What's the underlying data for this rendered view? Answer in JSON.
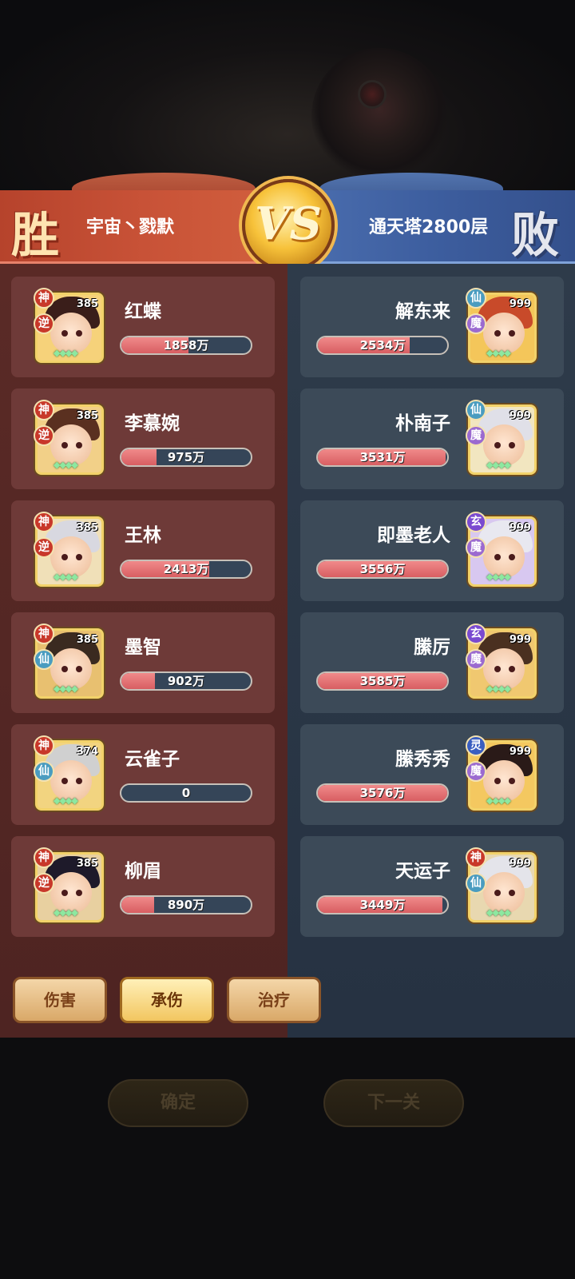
{
  "banner": {
    "left_result": "胜",
    "left_team": "宇宙丶戮默",
    "vs_label": "VS",
    "right_team": "通天塔2800层",
    "right_result": "败"
  },
  "left_heroes": [
    {
      "name": "红蝶",
      "level": "385",
      "tag1": "神",
      "tag2": "逆",
      "value": "1858万",
      "fill": 0.52
    },
    {
      "name": "李慕婉",
      "level": "385",
      "tag1": "神",
      "tag2": "逆",
      "value": "975万",
      "fill": 0.27
    },
    {
      "name": "王林",
      "level": "385",
      "tag1": "神",
      "tag2": "逆",
      "value": "2413万",
      "fill": 0.68
    },
    {
      "name": "墨智",
      "level": "385",
      "tag1": "神",
      "tag2": "仙",
      "value": "902万",
      "fill": 0.26
    },
    {
      "name": "云雀子",
      "level": "374",
      "tag1": "神",
      "tag2": "仙",
      "value": "0",
      "fill": 0
    },
    {
      "name": "柳眉",
      "level": "385",
      "tag1": "神",
      "tag2": "逆",
      "value": "890万",
      "fill": 0.25
    }
  ],
  "right_heroes": [
    {
      "name": "解东来",
      "level": "999",
      "tag1": "仙",
      "tag2": "魔",
      "value": "2534万",
      "fill": 0.71
    },
    {
      "name": "朴南子",
      "level": "999",
      "tag1": "仙",
      "tag2": "魔",
      "value": "3531万",
      "fill": 0.99
    },
    {
      "name": "即墨老人",
      "level": "999",
      "tag1": "玄",
      "tag2": "魔",
      "value": "3556万",
      "fill": 1.0
    },
    {
      "name": "縢厉",
      "level": "999",
      "tag1": "玄",
      "tag2": "魔",
      "value": "3585万",
      "fill": 1.0
    },
    {
      "name": "縢秀秀",
      "level": "999",
      "tag1": "灵",
      "tag2": "魔",
      "value": "3576万",
      "fill": 1.0
    },
    {
      "name": "天运子",
      "level": "999",
      "tag1": "神",
      "tag2": "仙",
      "value": "3449万",
      "fill": 0.96
    }
  ],
  "tabs": [
    "伤害",
    "承伤",
    "治疗"
  ],
  "active_tab": "承伤",
  "buttons": {
    "confirm": "确定",
    "next": "下一关"
  },
  "colors": {
    "win_red": "#c85237",
    "lose_blue": "#3d5e9f",
    "bar_fill": "#d85e62",
    "tag_shen": "#c8382a",
    "tag_ni": "#c8382a",
    "tag_xian": "#4a9cc0",
    "tag_mo": "#9b6ad0",
    "tag_xuan": "#7a4ad0",
    "tag_ling": "#3a5ec0"
  }
}
